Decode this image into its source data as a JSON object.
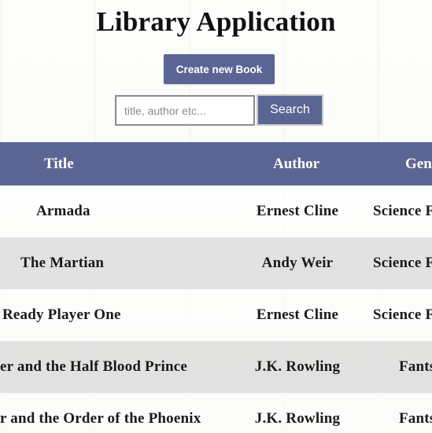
{
  "header": {
    "title": "Library Application",
    "create_button": "Create new Book",
    "search_placeholder": "title, author etc...",
    "search_button": "Search"
  },
  "table": {
    "columns": [
      "Title",
      "Author",
      "Gen"
    ],
    "rows": [
      {
        "title": "Armada",
        "author": "Ernest Cline",
        "genre": "Science F"
      },
      {
        "title": "The Martian",
        "author": "Andy Weir",
        "genre": "Science F"
      },
      {
        "title": "Ready Player One",
        "author": "Ernest Cline",
        "genre": "Science F"
      },
      {
        "title": "er and the Half Blood Prince",
        "author": "J.K. Rowling",
        "genre": "Fants"
      },
      {
        "title": "r and the Order of the Phoenix",
        "author": "J.K. Rowling",
        "genre": "Fants"
      }
    ]
  },
  "colors": {
    "accent": "#5a6593",
    "row_alt": "#e0e0e0",
    "row": "#ffffff"
  }
}
